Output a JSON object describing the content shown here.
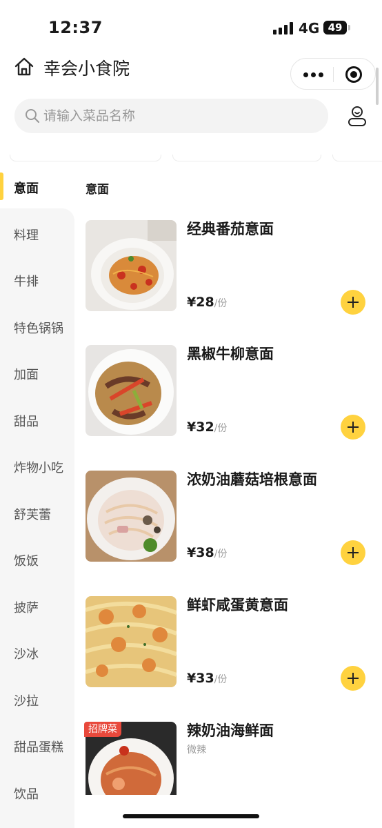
{
  "status_bar": {
    "time": "12:37",
    "network": "4G",
    "battery": "49"
  },
  "header": {
    "title": "幸会小食院"
  },
  "search": {
    "placeholder": "请输入菜品名称"
  },
  "sidebar": {
    "items": [
      {
        "label": "意面",
        "active": true
      },
      {
        "label": "料理"
      },
      {
        "label": "牛排"
      },
      {
        "label": "特色锅锅"
      },
      {
        "label": "加面"
      },
      {
        "label": "甜品"
      },
      {
        "label": "炸物小吃"
      },
      {
        "label": "舒芙蕾"
      },
      {
        "label": "饭饭"
      },
      {
        "label": "披萨"
      },
      {
        "label": "沙冰"
      },
      {
        "label": "沙拉"
      },
      {
        "label": "甜品蛋糕"
      },
      {
        "label": "饮品"
      }
    ]
  },
  "section": {
    "title": "意面"
  },
  "dishes": [
    {
      "name": "经典番茄意面",
      "price": "¥28",
      "unit": "/份"
    },
    {
      "name": "黑椒牛柳意面",
      "price": "¥32",
      "unit": "/份"
    },
    {
      "name": "浓奶油蘑菇培根意面",
      "price": "¥38",
      "unit": "/份"
    },
    {
      "name": "鲜虾咸蛋黄意面",
      "price": "¥33",
      "unit": "/份"
    },
    {
      "name": "辣奶油海鲜面",
      "tag": "微辣",
      "badge": "招牌菜"
    }
  ],
  "colors": {
    "accent": "#ffd23f",
    "badge": "#e8493c"
  }
}
